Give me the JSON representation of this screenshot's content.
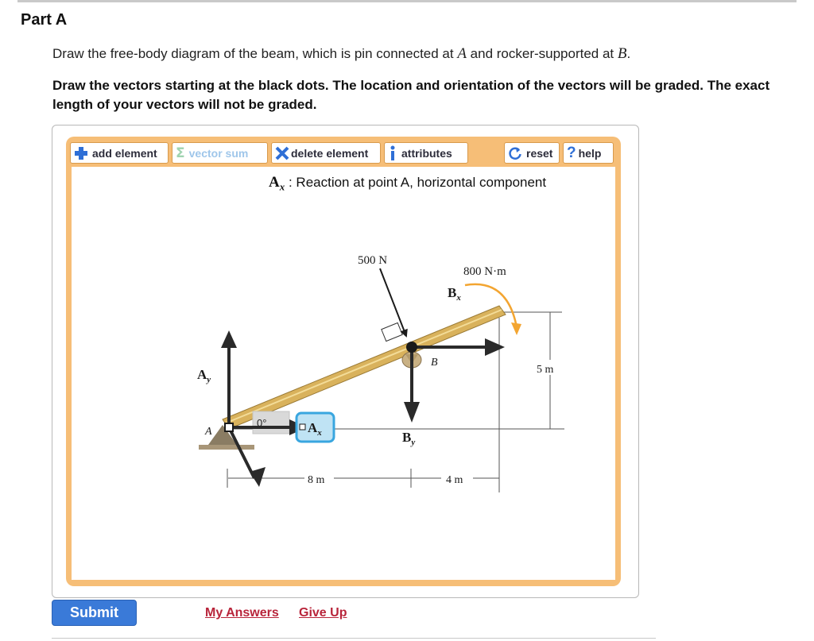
{
  "part": {
    "title": "Part A"
  },
  "instructions": {
    "line_pre": "Draw the free-body diagram of the beam, which is pin connected at ",
    "point_a": "A",
    "line_mid": " and rocker-supported at ",
    "point_b": "B",
    "line_end": ".",
    "bold_text": "Draw the vectors starting at the black dots. The location and orientation of the vectors will be graded. The exact length of your vectors will not be graded."
  },
  "toolbar": {
    "add_element": "add element",
    "vector_sum": "vector sum",
    "delete_element": "delete element",
    "attributes": "attributes",
    "reset": "reset",
    "help": "help"
  },
  "status": {
    "symbol": "A",
    "subscript": "x",
    "description": ": Reaction at point A, horizontal component"
  },
  "diagram": {
    "force_label": "500 N",
    "moment_label": "800 N·m",
    "height_label": "5 m",
    "dist_ab_label": "8 m",
    "dist_b_end_label": "4 m",
    "point_a_label": "A",
    "point_b_label": "B",
    "vectors": {
      "ay": {
        "symbol": "A",
        "sub": "y"
      },
      "ax": {
        "symbol": "A",
        "sub": "x",
        "angle": "0°"
      },
      "bx": {
        "symbol": "B",
        "sub": "x"
      },
      "by": {
        "symbol": "B",
        "sub": "y"
      }
    }
  },
  "actions": {
    "submit": "Submit",
    "my_answers": "My Answers",
    "give_up": "Give Up"
  },
  "colors": {
    "applet_border": "#f6be77",
    "submit_blue": "#3a7ad8",
    "selected_blue": "#3c74d9",
    "link_red": "#b8243a",
    "beam": "#d9b25c"
  }
}
